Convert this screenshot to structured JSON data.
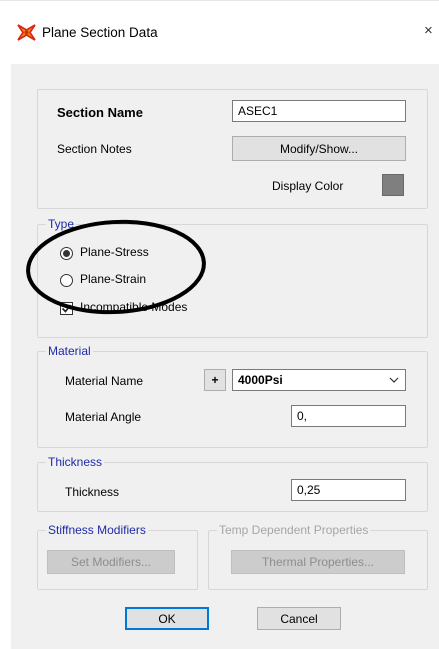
{
  "window": {
    "title": "Plane Section Data",
    "close_glyph": "×"
  },
  "section": {
    "name_label": "Section Name",
    "name_value": "ASEC1",
    "notes_label": "Section Notes",
    "notes_button": "Modify/Show...",
    "color_label": "Display Color",
    "color_value": "#7f7f7f"
  },
  "type": {
    "group_label": "Type",
    "options": [
      {
        "label": "Plane-Stress",
        "selected": true
      },
      {
        "label": "Plane-Strain",
        "selected": false
      }
    ],
    "incompatible_label": "Incompatible Modes",
    "incompatible_checked": true
  },
  "material": {
    "group_label": "Material",
    "name_label": "Material Name",
    "plus_label": "+",
    "name_value": "4000Psi",
    "angle_label": "Material Angle",
    "angle_value": "0,"
  },
  "thickness": {
    "group_label": "Thickness",
    "label": "Thickness",
    "value": "0,25"
  },
  "stiffness": {
    "group_label": "Stiffness Modifiers",
    "button": "Set Modifiers..."
  },
  "temp": {
    "group_label": "Temp Dependent Properties",
    "button": "Thermal Properties..."
  },
  "footer": {
    "ok": "OK",
    "cancel": "Cancel"
  }
}
